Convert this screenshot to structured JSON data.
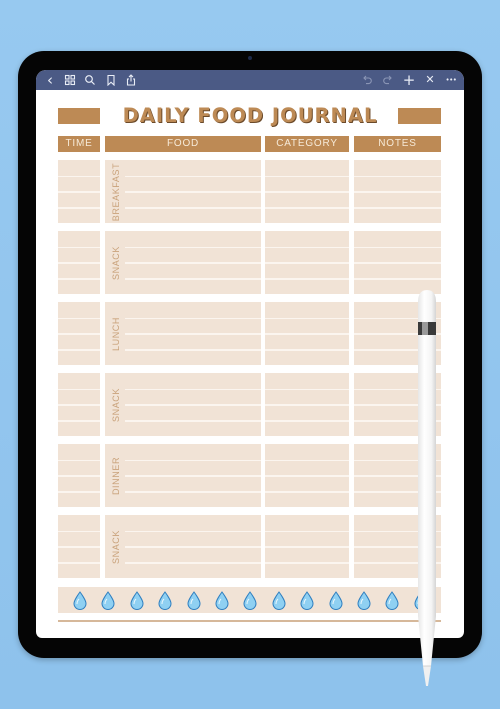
{
  "toolbar": {
    "left_icons": [
      "back-icon",
      "grid-icon",
      "search-icon",
      "bookmark-icon",
      "share-icon"
    ],
    "right_icons": [
      "undo-icon",
      "redo-icon",
      "add-icon",
      "close-icon",
      "more-icon"
    ],
    "back_glyph": "‹",
    "more_glyph": "•••",
    "add_glyph": "+",
    "close_glyph": "✕"
  },
  "journal": {
    "title": "DAILY FOOD JOURNAL",
    "columns": [
      "TIME",
      "FOOD",
      "CATEGORY",
      "NOTES"
    ],
    "sections": [
      {
        "label": "BREAKFAST"
      },
      {
        "label": "SNACK"
      },
      {
        "label": "LUNCH"
      },
      {
        "label": "SNACK"
      },
      {
        "label": "DINNER"
      },
      {
        "label": "SNACK"
      }
    ],
    "water_drops_visible": 13
  },
  "colors": {
    "accent": "#bd8a55",
    "cell_fill": "#f1e3d6",
    "toolbar": "#4b5a85",
    "water": "#8fd0f2",
    "background": "#93c6ee"
  }
}
